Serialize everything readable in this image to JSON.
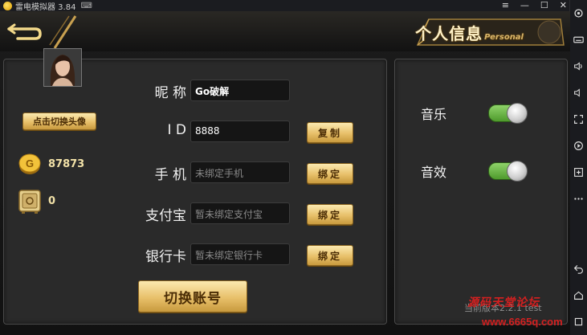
{
  "emulator": {
    "title": "雷电模拟器 3.84",
    "controls": {
      "menu": "≡",
      "minimize": "—",
      "maximize": "☐",
      "close": "✕"
    }
  },
  "sidebar": {
    "items": [
      {
        "icon": "settings-icon"
      },
      {
        "icon": "keyboard-icon"
      },
      {
        "icon": "volume-up-icon"
      },
      {
        "icon": "volume-down-icon"
      },
      {
        "icon": "fullscreen-icon"
      },
      {
        "icon": "record-icon"
      },
      {
        "icon": "add-app-icon"
      },
      {
        "icon": "more-icon"
      },
      {
        "icon": "back-icon"
      },
      {
        "icon": "home-icon"
      },
      {
        "icon": "recent-apps-icon"
      }
    ]
  },
  "header": {
    "title": "个人信息",
    "subtitle": "Personal"
  },
  "profile": {
    "change_avatar_label": "点击切换头像",
    "gold": "87873",
    "safe": "0"
  },
  "fields": [
    {
      "label": "昵 称",
      "value": "Go破解",
      "filled": true
    },
    {
      "label": "I D",
      "value": "8888",
      "filled": true,
      "action": "复制"
    },
    {
      "label": "手 机",
      "value": "未绑定手机",
      "filled": false,
      "action": "绑定"
    },
    {
      "label": "支付宝",
      "value": "暂未绑定支付宝",
      "filled": false,
      "action": "绑定"
    },
    {
      "label": "银行卡",
      "value": "暂未绑定银行卡",
      "filled": false,
      "action": "绑定"
    }
  ],
  "switch_account_label": "切换账号",
  "settings": {
    "music_label": "音乐",
    "music_on": true,
    "sfx_label": "音效",
    "sfx_on": true
  },
  "version_text": "当前版本2.2.1 test",
  "watermark": {
    "line1": "源码天堂论坛",
    "line2": "www.6665q.com"
  },
  "colors": {
    "gold_button": "#e8c06a",
    "toggle_on": "#6ab84a",
    "watermark": "#d42020"
  }
}
